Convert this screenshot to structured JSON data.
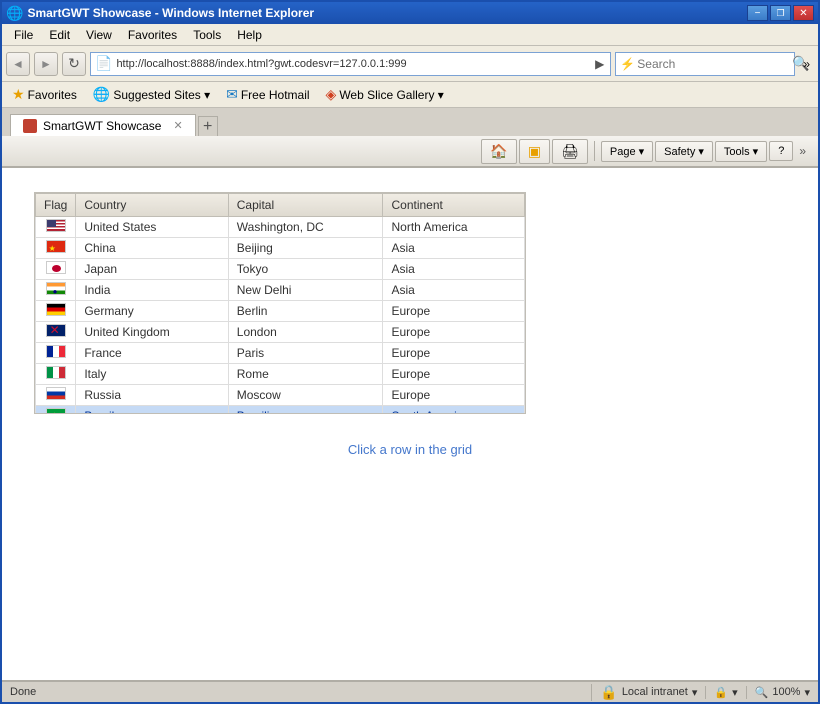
{
  "titleBar": {
    "title": "SmartGWT Showcase - Windows Internet Explorer",
    "buttons": {
      "minimize": "−",
      "restore": "❐",
      "close": "✕"
    }
  },
  "navBar": {
    "backBtn": "◄",
    "forwardBtn": "►",
    "refreshBtn": "↻",
    "addressUrl": "http://localhost:8888/index.html?gwt.codesvr=127.0.0.1:999",
    "searchPlaceholder": "Search"
  },
  "favoritesBar": {
    "favoritesLabel": "Favorites",
    "suggestedLabel": "Suggested Sites ▾",
    "hotmailLabel": "Free Hotmail",
    "webSliceLabel": "Web Slice Gallery ▾"
  },
  "tabBar": {
    "tabLabel": "SmartGWT Showcase",
    "newTabTooltip": "New Tab"
  },
  "toolbar": {
    "pageLabel": "Page ▾",
    "safetyLabel": "Safety ▾",
    "toolsLabel": "Tools ▾",
    "helpBtn": "?"
  },
  "menuBar": {
    "items": [
      "File",
      "Edit",
      "View",
      "Favorites",
      "Tools",
      "Help"
    ]
  },
  "grid": {
    "columns": [
      "Flag",
      "Country",
      "Capital",
      "Continent"
    ],
    "rows": [
      {
        "flag": "us",
        "country": "United States",
        "capital": "Washington, DC",
        "continent": "North America",
        "selected": false
      },
      {
        "flag": "cn",
        "country": "China",
        "capital": "Beijing",
        "continent": "Asia",
        "selected": false
      },
      {
        "flag": "jp",
        "country": "Japan",
        "capital": "Tokyo",
        "continent": "Asia",
        "selected": false
      },
      {
        "flag": "in",
        "country": "India",
        "capital": "New Delhi",
        "continent": "Asia",
        "selected": false
      },
      {
        "flag": "de",
        "country": "Germany",
        "capital": "Berlin",
        "continent": "Europe",
        "selected": false
      },
      {
        "flag": "gb",
        "country": "United Kingdom",
        "capital": "London",
        "continent": "Europe",
        "selected": false
      },
      {
        "flag": "fr",
        "country": "France",
        "capital": "Paris",
        "continent": "Europe",
        "selected": false
      },
      {
        "flag": "it",
        "country": "Italy",
        "capital": "Rome",
        "continent": "Europe",
        "selected": false
      },
      {
        "flag": "ru",
        "country": "Russia",
        "capital": "Moscow",
        "continent": "Europe",
        "selected": false
      },
      {
        "flag": "br",
        "country": "Brazil",
        "capital": "Brasilia",
        "continent": "South America",
        "selected": true
      }
    ]
  },
  "clickMessage": "Click a row in the grid",
  "statusBar": {
    "statusText": "Done",
    "zoneText": "Local intranet",
    "zoomText": "100%",
    "zoomIcon": "🔍"
  }
}
